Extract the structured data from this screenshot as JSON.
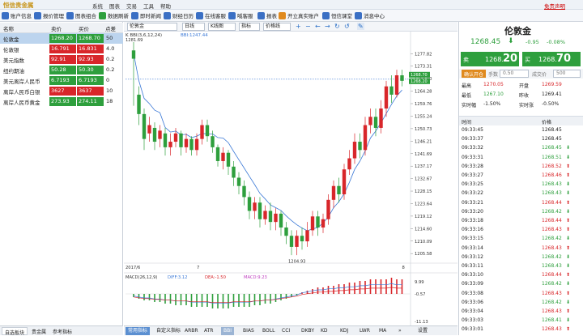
{
  "app": {
    "logo_text": "恒信贵金属",
    "menu": [
      "系统",
      "图表",
      "交易",
      "工具",
      "帮助"
    ],
    "free_statement": "免责声明",
    "window_controls": "— ▢ ✕"
  },
  "toolbar": [
    {
      "label": "账户信息",
      "color": "#3a6fc4"
    },
    {
      "label": "报价管理",
      "color": "#3a6fc4"
    },
    {
      "label": "图表组合",
      "color": "#3a6fc4"
    },
    {
      "label": "数据刷新",
      "color": "#2e9f3d"
    },
    {
      "label": "即时新闻",
      "color": "#3a6fc4"
    },
    {
      "label": "财经日历",
      "color": "#3a6fc4"
    },
    {
      "label": "在线客服",
      "color": "#3a6fc4"
    },
    {
      "label": "喊客服",
      "color": "#3a6fc4"
    },
    {
      "label": "报表",
      "color": "#3a6fc4"
    },
    {
      "label": "开立真实账户",
      "color": "#e08a1e"
    },
    {
      "label": "恒信课堂",
      "color": "#3a6fc4"
    },
    {
      "label": "消息中心",
      "color": "#3a6fc4"
    }
  ],
  "watchlist": {
    "headers": [
      "名称",
      "卖价",
      "买价",
      "点差"
    ],
    "rows": [
      {
        "name": "伦敦金",
        "sell": "1268.20",
        "buy": "1268.70",
        "spread": "50",
        "sell_color": "#2e9f3d",
        "buy_color": "#2e9f3d",
        "selected": true
      },
      {
        "name": "伦敦银",
        "sell": "16.791",
        "buy": "16.831",
        "spread": "4.0",
        "sell_color": "#d8262a",
        "buy_color": "#d8262a"
      },
      {
        "name": "美元指数",
        "sell": "92.91",
        "buy": "92.93",
        "spread": "0.2",
        "sell_color": "#d8262a",
        "buy_color": "#d8262a"
      },
      {
        "name": "纽约期油",
        "sell": "50.28",
        "buy": "50.30",
        "spread": "0.2",
        "sell_color": "#2e9f3d",
        "buy_color": "#2e9f3d"
      },
      {
        "name": "美元离岸人民币",
        "sell": "6.7193",
        "buy": "6.7193",
        "spread": "0",
        "sell_color": "#2e9f3d",
        "buy_color": "#2e9f3d"
      },
      {
        "name": "离岸人民币白银",
        "sell": "3627",
        "buy": "3637",
        "spread": "10",
        "sell_color": "#d8262a",
        "buy_color": "#d8262a"
      },
      {
        "name": "离岸人民币黄金",
        "sell": "273.93",
        "buy": "274.11",
        "spread": "18",
        "sell_color": "#2e9f3d",
        "buy_color": "#2e9f3d"
      }
    ]
  },
  "left_tabs": [
    "自选板块",
    "贵金属",
    "参考指标"
  ],
  "chart_toolbar": {
    "symbol": "伦敦金",
    "period": "日线",
    "type": "K线图",
    "indicator": "指标",
    "price_line": "价格线",
    "glyphs": [
      "+",
      "−",
      "←",
      "→",
      "↻",
      "↺",
      "✎"
    ]
  },
  "chart_header": {
    "label": "K  BBI(3,6,12,24)",
    "bbi": "BBI:1247.44",
    "high_mark": "1281.69"
  },
  "price_axis": [
    "1277.82",
    "1273.31",
    "1268.80",
    "1264.28",
    "1259.76",
    "1255.24",
    "1250.73",
    "1246.21",
    "1241.69",
    "1237.17",
    "1232.67",
    "1228.15",
    "1223.64",
    "1219.12",
    "1214.60",
    "1210.09",
    "1205.58"
  ],
  "price_tags": {
    "sell": "1268.70",
    "buy": "1268.20"
  },
  "low_mark": "1204.93",
  "date_axis": [
    "2017/6",
    "7",
    "8"
  ],
  "macd": {
    "label": "MACD(26,12,9)",
    "diff": "DIFF:3.12",
    "dea": "DEA:-1.50",
    "macd": "MACD:9.23",
    "axis": [
      "9.99",
      "-0.57",
      "-11.13"
    ]
  },
  "bottom_tabs": [
    "常用指标",
    "自定义指标",
    "ARBR",
    "ATR",
    "BBI",
    "BIAS",
    "BOLL",
    "CCI",
    "DKBY",
    "KD",
    "KDJ",
    "LWR",
    "MA",
    "»",
    "设置"
  ],
  "quote": {
    "name": "伦敦金",
    "price": "1268.45",
    "arrow": "⬇",
    "change": "-0.95",
    "pct": "-0.08%",
    "sell_label": "卖",
    "sell_big": "1268.",
    "sell_small": "20",
    "buy_label": "买",
    "buy_big": "1268.",
    "buy_small": "70",
    "confirm": "确认开仓",
    "lot_label": "手数",
    "lot": "0.50",
    "price_label": "成交价",
    "pts": "500",
    "stats": [
      {
        "k1": "最高",
        "v1": "1270.05",
        "c1": "#d8262a",
        "k2": "开盘",
        "v2": "1269.59",
        "c2": "#d8262a"
      },
      {
        "k1": "最低",
        "v1": "1267.10",
        "c1": "#2e9f3d",
        "k2": "昨收",
        "v2": "1269.41",
        "c2": "#222"
      },
      {
        "k1": "实时幅",
        "v1": "-1.50%",
        "c1": "#222",
        "k2": "实时涨",
        "v2": "-0.50%",
        "c2": "#222"
      }
    ]
  },
  "ticks": {
    "headers": [
      "时间",
      "价格"
    ],
    "rows": [
      {
        "t": "09:33:45",
        "p": "1268.45",
        "a": "",
        "c": "#222"
      },
      {
        "t": "09:33:37",
        "p": "1268.45",
        "a": "",
        "c": "#222"
      },
      {
        "t": "09:33:32",
        "p": "1268.45",
        "a": "⬇",
        "c": "#2e9f3d"
      },
      {
        "t": "09:33:31",
        "p": "1268.51",
        "a": "⬇",
        "c": "#2e9f3d"
      },
      {
        "t": "09:33:28",
        "p": "1268.52",
        "a": "⬆",
        "c": "#d8262a"
      },
      {
        "t": "09:33:27",
        "p": "1268.46",
        "a": "⬆",
        "c": "#d8262a"
      },
      {
        "t": "09:33:25",
        "p": "1268.43",
        "a": "⬇",
        "c": "#2e9f3d"
      },
      {
        "t": "09:33:22",
        "p": "1268.43",
        "a": "⬇",
        "c": "#2e9f3d"
      },
      {
        "t": "09:33:21",
        "p": "1268.44",
        "a": "⬆",
        "c": "#d8262a"
      },
      {
        "t": "09:33:20",
        "p": "1268.42",
        "a": "⬇",
        "c": "#2e9f3d"
      },
      {
        "t": "09:33:18",
        "p": "1268.44",
        "a": "⬆",
        "c": "#d8262a"
      },
      {
        "t": "09:33:16",
        "p": "1268.43",
        "a": "⬆",
        "c": "#d8262a"
      },
      {
        "t": "09:33:15",
        "p": "1268.42",
        "a": "⬇",
        "c": "#2e9f3d"
      },
      {
        "t": "09:33:14",
        "p": "1268.43",
        "a": "⬆",
        "c": "#d8262a"
      },
      {
        "t": "09:33:12",
        "p": "1268.42",
        "a": "⬇",
        "c": "#2e9f3d"
      },
      {
        "t": "09:33:11",
        "p": "1268.43",
        "a": "⬇",
        "c": "#2e9f3d"
      },
      {
        "t": "09:33:10",
        "p": "1268.44",
        "a": "⬆",
        "c": "#d8262a"
      },
      {
        "t": "09:33:09",
        "p": "1268.42",
        "a": "⬇",
        "c": "#2e9f3d"
      },
      {
        "t": "09:33:08",
        "p": "1268.43",
        "a": "⬆",
        "c": "#d8262a"
      },
      {
        "t": "09:33:06",
        "p": "1268.42",
        "a": "⬇",
        "c": "#2e9f3d"
      },
      {
        "t": "09:33:04",
        "p": "1268.43",
        "a": "⬆",
        "c": "#d8262a"
      },
      {
        "t": "09:33:03",
        "p": "1268.41",
        "a": "⬇",
        "c": "#2e9f3d"
      },
      {
        "t": "09:33:01",
        "p": "1268.43",
        "a": "⬆",
        "c": "#d8262a"
      }
    ]
  },
  "chart_data": {
    "type": "candlestick",
    "ylim": [
      1203,
      1282
    ],
    "candles": [
      [
        1279,
        1276,
        1282,
        1259
      ],
      [
        1263,
        1256,
        1266,
        1252
      ],
      [
        1256,
        1247,
        1258,
        1243
      ],
      [
        1249,
        1252,
        1255,
        1246
      ],
      [
        1251,
        1246,
        1253,
        1243
      ],
      [
        1247,
        1250,
        1252,
        1244
      ],
      [
        1249,
        1244,
        1251,
        1241
      ],
      [
        1244,
        1246,
        1249,
        1241
      ],
      [
        1246,
        1249,
        1251,
        1244
      ],
      [
        1249,
        1244,
        1250,
        1241
      ],
      [
        1244,
        1247,
        1249,
        1242
      ],
      [
        1247,
        1243,
        1248,
        1241
      ],
      [
        1243,
        1247,
        1249,
        1241
      ],
      [
        1247,
        1252,
        1254,
        1245
      ],
      [
        1252,
        1248,
        1254,
        1246
      ],
      [
        1248,
        1244,
        1250,
        1242
      ],
      [
        1244,
        1239,
        1245,
        1237
      ],
      [
        1239,
        1242,
        1244,
        1236
      ],
      [
        1242,
        1237,
        1243,
        1234
      ],
      [
        1237,
        1233,
        1239,
        1230
      ],
      [
        1233,
        1230,
        1235,
        1227
      ],
      [
        1230,
        1226,
        1232,
        1223
      ],
      [
        1226,
        1221,
        1228,
        1218
      ],
      [
        1221,
        1224,
        1226,
        1218
      ],
      [
        1224,
        1218,
        1226,
        1215
      ],
      [
        1218,
        1221,
        1223,
        1216
      ],
      [
        1221,
        1217,
        1224,
        1214
      ],
      [
        1217,
        1220,
        1222,
        1214
      ],
      [
        1220,
        1215,
        1221,
        1212
      ],
      [
        1215,
        1212,
        1217,
        1209
      ],
      [
        1212,
        1208,
        1214,
        1205
      ],
      [
        1208,
        1212,
        1214,
        1205
      ],
      [
        1212,
        1210,
        1215,
        1207
      ],
      [
        1210,
        1214,
        1217,
        1208
      ],
      [
        1214,
        1219,
        1221,
        1212
      ],
      [
        1219,
        1215,
        1221,
        1212
      ],
      [
        1215,
        1218,
        1220,
        1213
      ],
      [
        1218,
        1225,
        1227,
        1216
      ],
      [
        1225,
        1230,
        1232,
        1222
      ],
      [
        1230,
        1227,
        1233,
        1224
      ],
      [
        1227,
        1236,
        1238,
        1225
      ],
      [
        1236,
        1240,
        1243,
        1234
      ],
      [
        1240,
        1246,
        1249,
        1238
      ],
      [
        1246,
        1243,
        1249,
        1240
      ],
      [
        1243,
        1252,
        1255,
        1241
      ],
      [
        1252,
        1255,
        1258,
        1249
      ],
      [
        1255,
        1251,
        1258,
        1248
      ],
      [
        1251,
        1258,
        1261,
        1249
      ],
      [
        1258,
        1266,
        1268,
        1255
      ],
      [
        1266,
        1263,
        1270,
        1260
      ],
      [
        1263,
        1270,
        1272,
        1262
      ],
      [
        1270,
        1268,
        1272,
        1266
      ]
    ],
    "macd_hist": [
      -2,
      -3,
      -4,
      -4,
      -5,
      -5,
      -6,
      -6,
      -7,
      -7,
      -7,
      -8,
      -8,
      -8,
      -8,
      -9,
      -9,
      -9,
      -9,
      -8,
      -8,
      -8,
      -8,
      -7,
      -7,
      -6,
      -6,
      -5,
      -4,
      -3,
      -2,
      -1,
      1,
      2,
      3,
      4,
      4,
      5,
      5,
      6,
      6,
      7,
      7,
      8,
      8,
      9,
      9,
      9,
      9,
      10,
      9,
      9
    ]
  }
}
